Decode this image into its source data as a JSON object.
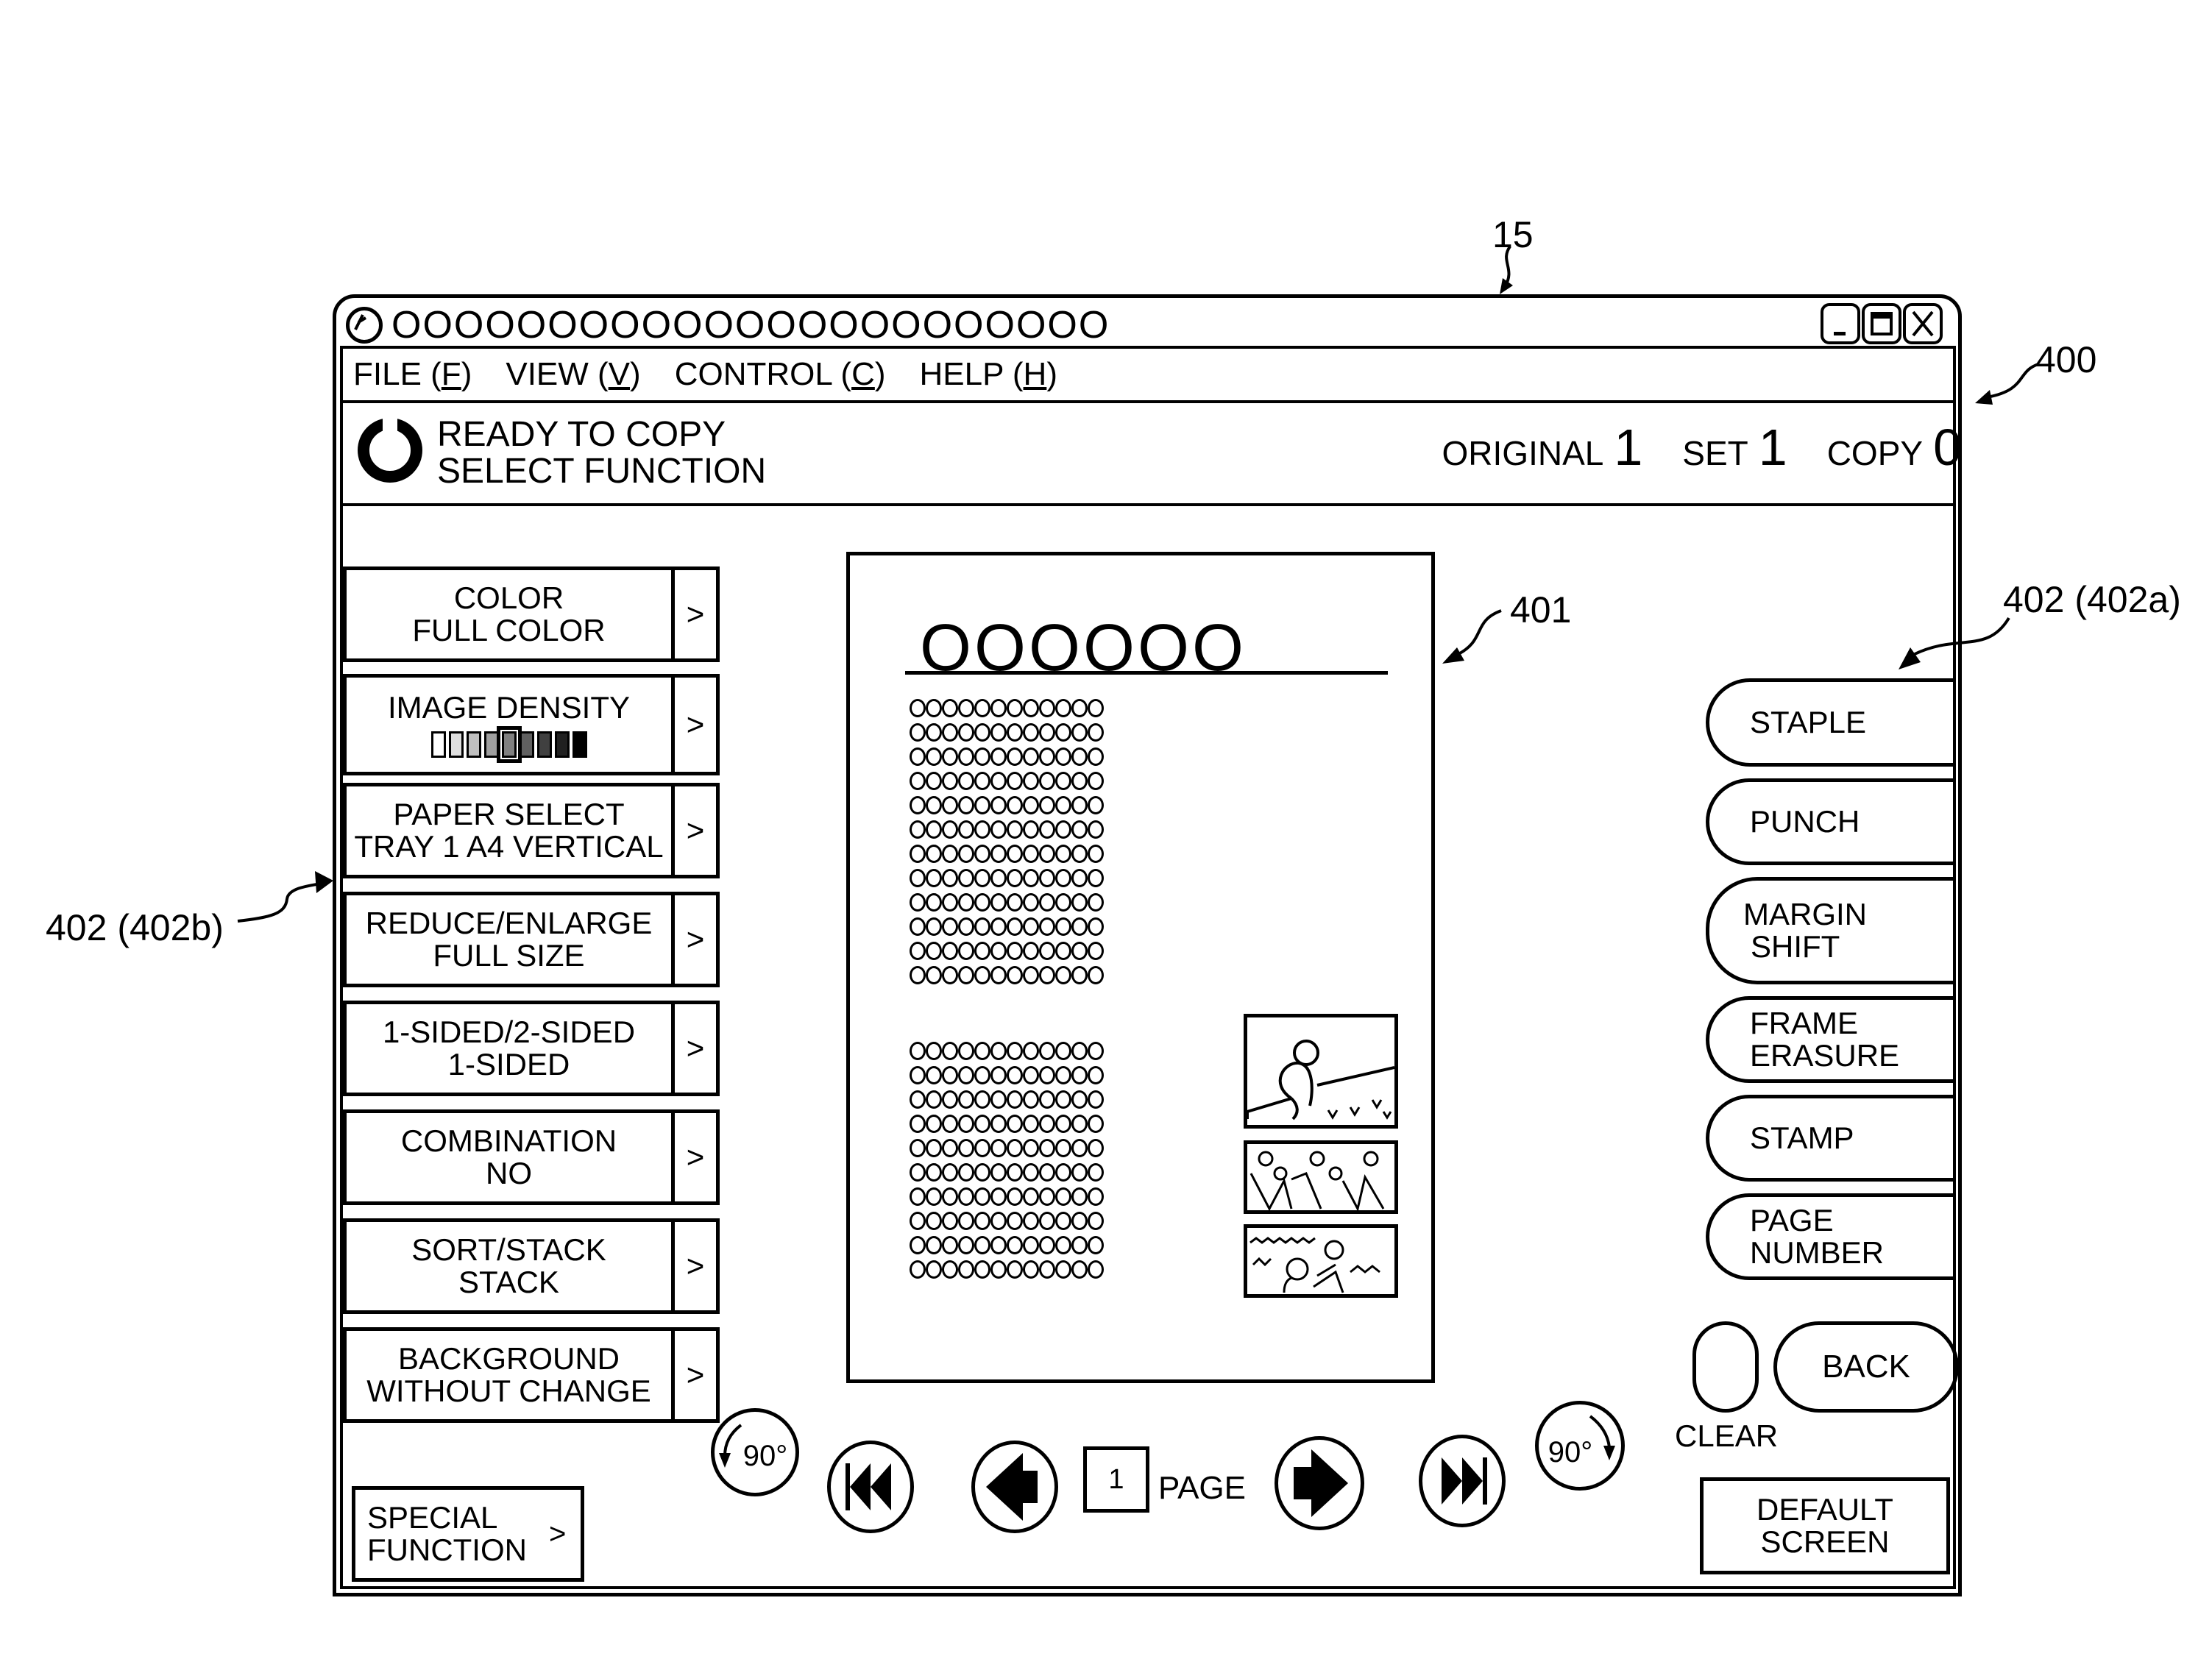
{
  "annotations": {
    "device_ref": "15",
    "screen_ref": "400",
    "preview_ref": "401",
    "right_group_ref": "402 (402a)",
    "left_group_ref": "402 (402b)"
  },
  "window": {
    "title": "OOOOOOOOOOOOOOOOOOOOOOO",
    "controls": {
      "minimize": "_",
      "maximize": "□",
      "close": "X"
    }
  },
  "menu": [
    {
      "label": "FILE (",
      "key": "F",
      "end": ")"
    },
    {
      "label": "VIEW (",
      "key": "V",
      "end": ")"
    },
    {
      "label": "CONTROL (",
      "key": "C",
      "end": ")"
    },
    {
      "label": "HELP (",
      "key": "H",
      "end": ")"
    }
  ],
  "status": {
    "line1": "READY TO COPY",
    "line2": "SELECT FUNCTION",
    "original_label": "ORIGINAL",
    "original_value": "1",
    "set_label": "SET",
    "set_value": "1",
    "copy_label": "COPY",
    "copy_value": "0"
  },
  "left_functions": [
    {
      "title": "COLOR",
      "value": "FULL COLOR",
      "arrow": ">"
    },
    {
      "title": "IMAGE DENSITY",
      "value": "",
      "arrow": ">",
      "density_levels": 9,
      "density_selected": 5
    },
    {
      "title": "PAPER SELECT",
      "value": "TRAY 1 A4 VERTICAL",
      "arrow": ">"
    },
    {
      "title": "REDUCE/ENLARGE",
      "value": "FULL SIZE",
      "arrow": ">"
    },
    {
      "title": "1-SIDED/2-SIDED",
      "value": "1-SIDED",
      "arrow": ">"
    },
    {
      "title": "COMBINATION",
      "value": "NO",
      "arrow": ">"
    },
    {
      "title": "SORT/STACK",
      "value": "STACK",
      "arrow": ">"
    },
    {
      "title": "BACKGROUND",
      "value": "WITHOUT CHANGE",
      "arrow": ">"
    }
  ],
  "special_function": {
    "line1": "SPECIAL",
    "line2": "FUNCTION",
    "arrow": ">"
  },
  "preview": {
    "heading": "OOOOOO",
    "grid1_rows": 12,
    "grid2_rows": 10,
    "grid_cols": 12,
    "photos": [
      "person-gardening-photo",
      "group-at-tables-photo",
      "two-people-outdoors-photo"
    ]
  },
  "right_functions": [
    {
      "line1": "STAPLE",
      "line2": ""
    },
    {
      "line1": "PUNCH",
      "line2": ""
    },
    {
      "line1": "MARGIN",
      "line2": "SHIFT"
    },
    {
      "line1": "FRAME",
      "line2": "ERASURE"
    },
    {
      "line1": "STAMP",
      "line2": ""
    },
    {
      "line1": "PAGE",
      "line2": "NUMBER"
    }
  ],
  "controls": {
    "clear_label": "CLEAR",
    "back_label": "BACK",
    "default_line1": "DEFAULT",
    "default_line2": "SCREEN"
  },
  "navigation": {
    "rotate_left_label": "90°",
    "rotate_right_label": "90°",
    "page_number": "1",
    "page_label": "PAGE"
  }
}
